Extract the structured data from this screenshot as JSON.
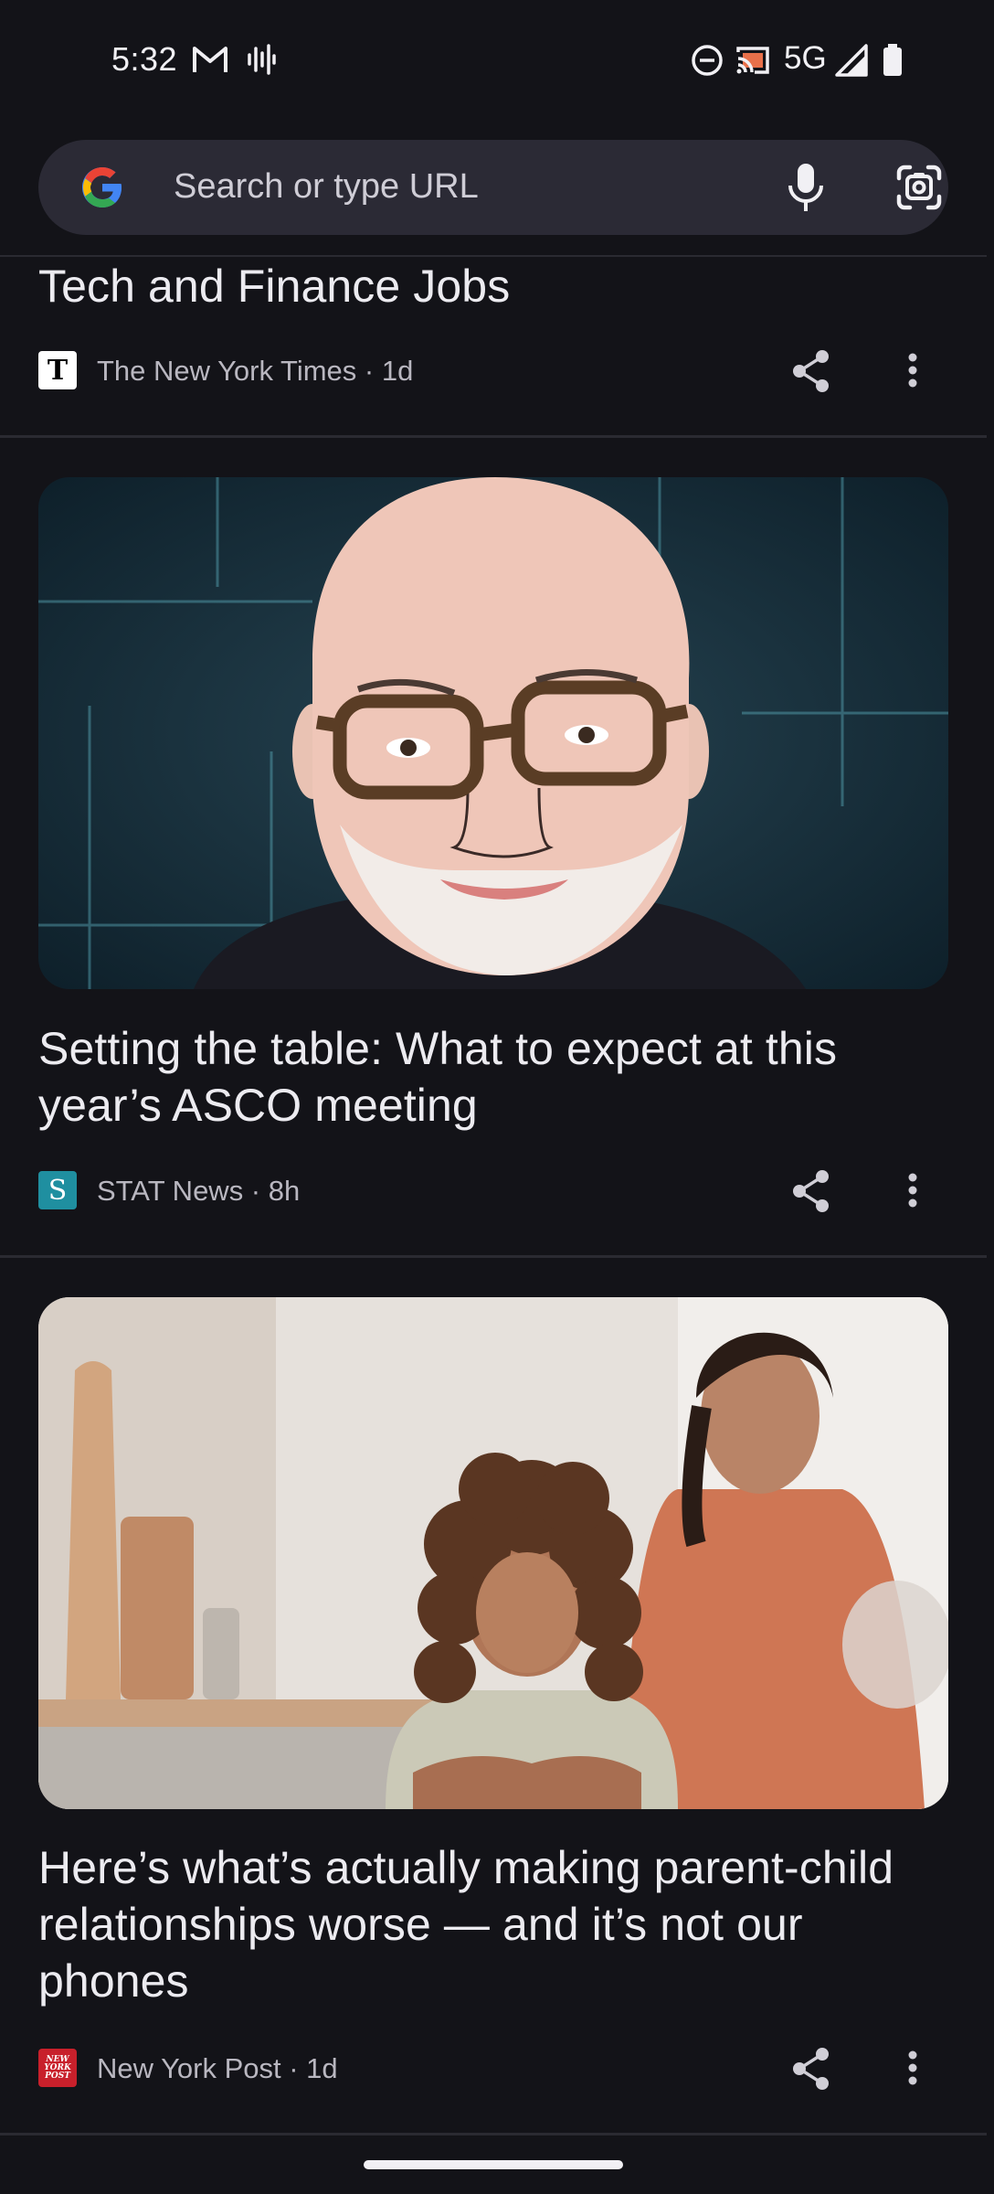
{
  "status_bar": {
    "time": "5:32",
    "network": "5G",
    "icons": [
      "gmail-icon",
      "sound-wave-icon",
      "do-not-disturb-icon",
      "cast-icon",
      "signal-icon",
      "battery-icon"
    ]
  },
  "search": {
    "placeholder": "Search or type URL",
    "icons": [
      "google-logo",
      "microphone-icon",
      "google-lens-icon"
    ]
  },
  "feed": [
    {
      "headline": "Tech and Finance Jobs",
      "source": "The New York Times · 1d",
      "publisher_icon_text": "T"
    },
    {
      "headline": "Setting the table: What to expect at this year’s ASCO meeting",
      "source": "STAT News · 8h",
      "publisher_icon_text": "S"
    },
    {
      "headline": "Here’s what’s actually making parent-child relationships worse — and it’s not our phones",
      "source": "New York Post · 1d",
      "publisher_icon_text": "NEW YORK POST"
    }
  ],
  "colors": {
    "background": "#131318",
    "search_bar": "#2b2a35",
    "text_primary": "#ecebf0",
    "text_secondary": "#b9b7c0",
    "divider": "#2a2a31"
  }
}
